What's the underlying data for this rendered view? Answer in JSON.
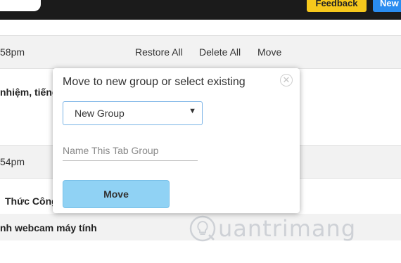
{
  "topbar": {
    "feedback_label": "Feedback",
    "new_label": "New"
  },
  "groups": [
    {
      "time": "58pm",
      "actions": [
        "Restore All",
        "Delete All",
        "Move"
      ],
      "tabs": [
        "nhiệm, tiếng"
      ]
    },
    {
      "time": "54pm",
      "tabs": [
        "Thức Công",
        "nh webcam máy tính"
      ]
    }
  ],
  "modal": {
    "title": "Move to new group or select existing",
    "select_value": "New Group",
    "name_placeholder": "Name This Tab Group",
    "move_label": "Move"
  },
  "watermark": {
    "text": "uantrimang"
  },
  "colors": {
    "topbar": "#1b1b1b",
    "feedback": "#f6c81c",
    "new": "#2a8cf0",
    "move_button": "#90d2f4"
  }
}
